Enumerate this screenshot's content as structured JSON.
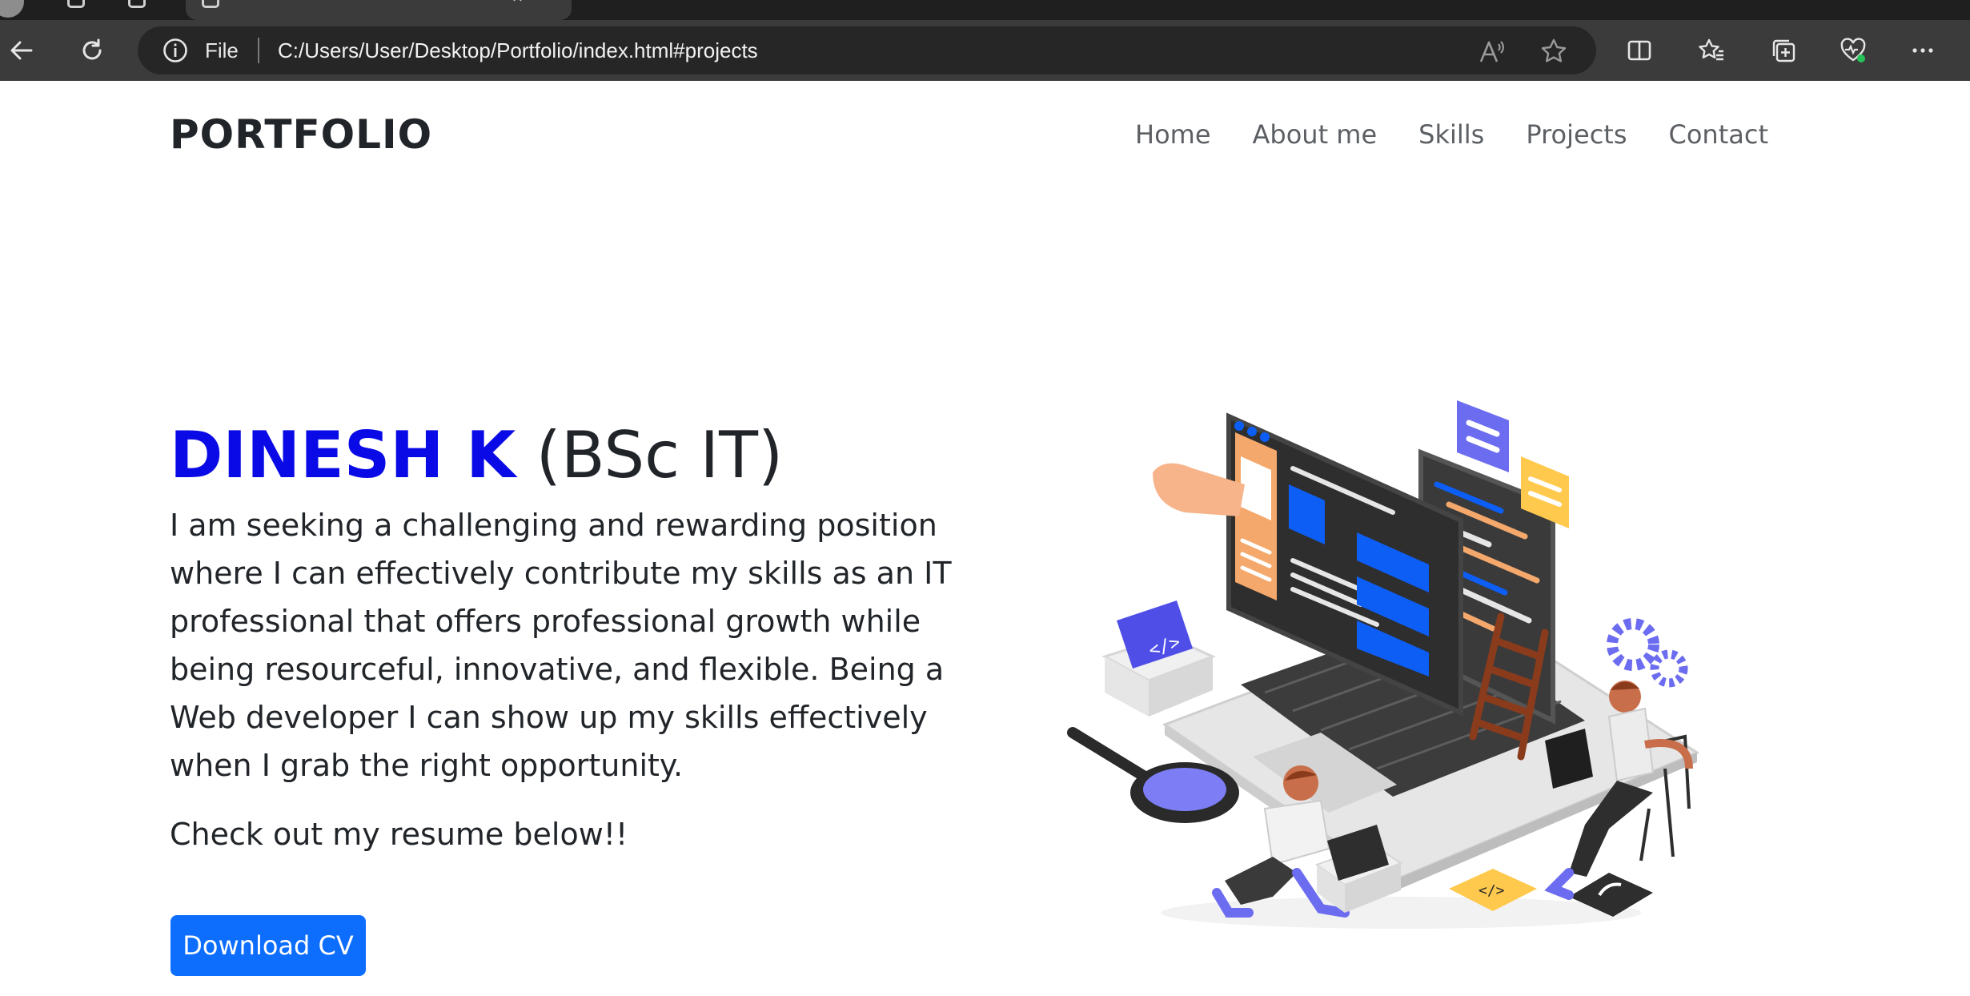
{
  "browser": {
    "scheme_label": "File",
    "url": "C:/Users/User/Desktop/Portfolio/index.html#projects",
    "icons": [
      "back-icon",
      "refresh-icon",
      "info-icon",
      "read-aloud-icon",
      "favorite-star-icon",
      "split-screen-icon",
      "favorites-icon",
      "collections-icon",
      "browser-essentials-icon",
      "more-icon"
    ]
  },
  "nav": {
    "brand": "PORTFOLIO",
    "links": [
      "Home",
      "About me",
      "Skills",
      "Projects",
      "Contact"
    ]
  },
  "hero": {
    "name": "DINESH K",
    "degree": "(BSc IT)",
    "description": "I am seeking a challenging and rewarding position where I can effectively contribute my skills as an IT professional that offers professional growth while being resourceful, innovative, and flexible. Being a Web developer I can show up my skills effectively when I grab the right opportunity.",
    "resume_note": "Check out my resume below!!",
    "download_label": "Download CV",
    "illustration_code_tag": "</>"
  },
  "colors": {
    "name_blue": "#0a0ae6",
    "button_blue": "#0d6efd",
    "illustration_blue": "#0d5ef5",
    "illustration_purple": "#6c6cf0",
    "illustration_orange": "#f4a86b",
    "illustration_yellow": "#ffc94d"
  }
}
